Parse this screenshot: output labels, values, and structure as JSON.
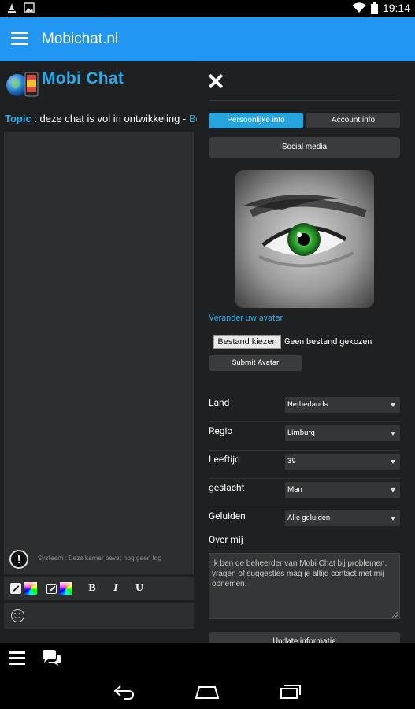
{
  "status_bar": {
    "time": "19:14"
  },
  "app_bar": {
    "title": "Mobichat.nl"
  },
  "chat": {
    "logo_text": "Mobi Chat",
    "topic_label": "Topic",
    "topic_text": " : deze chat is vol in ontwikkeling - ",
    "topic_more": "Beh",
    "system_message": "Systeem : Deze kamer bevat nog geen log",
    "toolbar": {
      "bold": "B",
      "italic": "I",
      "underline": "U"
    }
  },
  "profile": {
    "tabs": [
      {
        "label": "Persoonlijke info",
        "active": true
      },
      {
        "label": "Account info",
        "active": false
      }
    ],
    "social_media_label": "Social media",
    "change_avatar_label": "Verander uw avatar",
    "choose_file_label": "Bestand kiezen",
    "no_file_label": "Geen bestand gekozen",
    "submit_avatar_label": "Submit Avatar",
    "fields": [
      {
        "label": "Land",
        "value": "Netherlands"
      },
      {
        "label": "Regio",
        "value": "Limburg"
      },
      {
        "label": "Leeftijd",
        "value": "39"
      },
      {
        "label": "geslacht",
        "value": "Man"
      },
      {
        "label": "Geluiden",
        "value": "Alle geluiden"
      }
    ],
    "about_label": "Over mij",
    "about_text": "Ik ben de beheerder van Mobi Chat bij problemen, vragen of suggesties mag je altijd contact met mij opnemen.",
    "update_label": "Update informatie"
  },
  "colors": {
    "accent": "#2196f3",
    "link": "#2aa9e8",
    "tab_active": "#24a3dd"
  }
}
